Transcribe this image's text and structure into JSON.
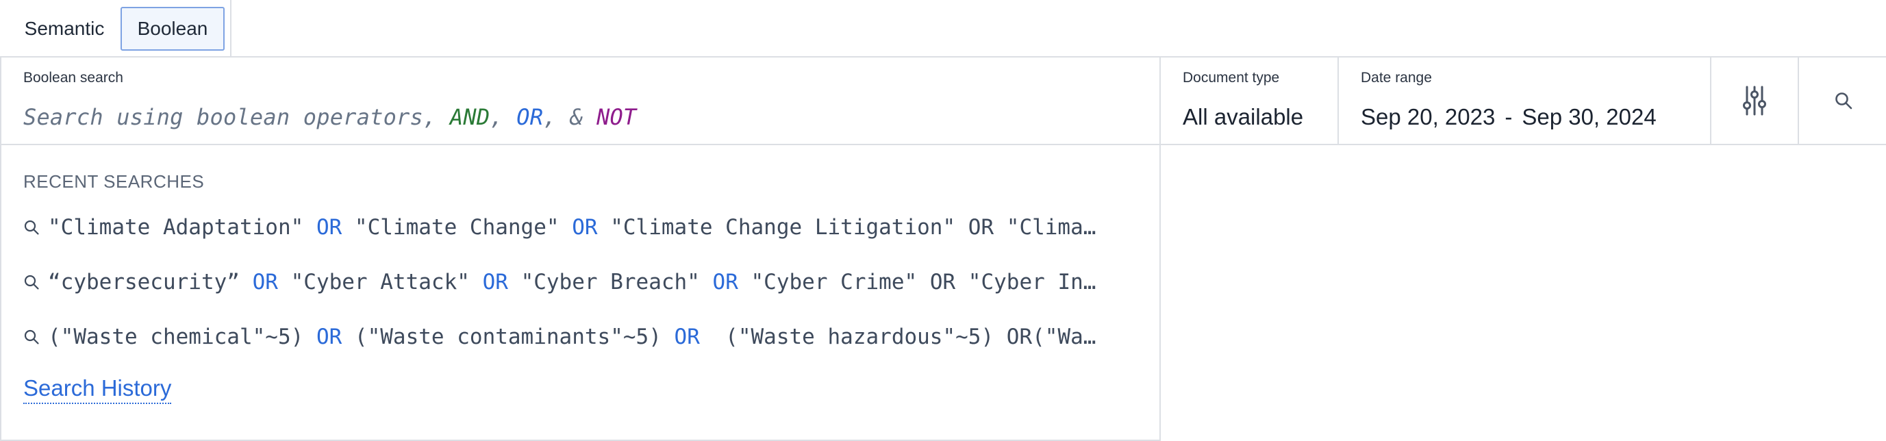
{
  "tabs": [
    {
      "label": "Semantic",
      "active": false
    },
    {
      "label": "Boolean",
      "active": true
    }
  ],
  "boolean_search": {
    "label": "Boolean search",
    "placeholder_prefix": "Search using boolean operators, ",
    "op_and": "AND",
    "sep1": ", ",
    "op_or": "OR",
    "sep2": ", & ",
    "op_not": "NOT"
  },
  "document_type": {
    "label": "Document type",
    "value": "All available"
  },
  "date_range": {
    "label": "Date range",
    "start": "Sep 20, 2023",
    "separator": "-",
    "end": "Sep 30, 2024"
  },
  "icons": {
    "filter": "sliders-icon",
    "search": "search-icon",
    "recent": "search-icon"
  },
  "colors": {
    "and": "#2a7a36",
    "or": "#2b6ad8",
    "not": "#8e1c8c",
    "link": "#2b6ad8",
    "active_tab_border": "#7ea3e3"
  },
  "recent": {
    "title": "RECENT SEARCHES",
    "items": [
      {
        "segments": [
          {
            "t": "\"Climate Adaptation\" "
          },
          {
            "t": "OR",
            "kw": true
          },
          {
            "t": " \"Climate Change\" "
          },
          {
            "t": "OR",
            "kw": true
          },
          {
            "t": " \"Climate Change Litigation\" OR \"Clima…"
          }
        ]
      },
      {
        "segments": [
          {
            "t": "“cybersecurity” "
          },
          {
            "t": "OR",
            "kw": true
          },
          {
            "t": " \"Cyber Attack\" "
          },
          {
            "t": "OR",
            "kw": true
          },
          {
            "t": " \"Cyber Breach\" "
          },
          {
            "t": "OR",
            "kw": true
          },
          {
            "t": " \"Cyber Crime\" OR \"Cyber In…"
          }
        ]
      },
      {
        "segments": [
          {
            "t": "(\"Waste chemical\"~5) "
          },
          {
            "t": "OR",
            "kw": true
          },
          {
            "t": " (\"Waste contaminants\"~5) "
          },
          {
            "t": "OR",
            "kw": true
          },
          {
            "t": "  (\"Waste hazardous\"~5) OR(\"Wa…"
          }
        ]
      }
    ],
    "history_link": "Search History"
  }
}
